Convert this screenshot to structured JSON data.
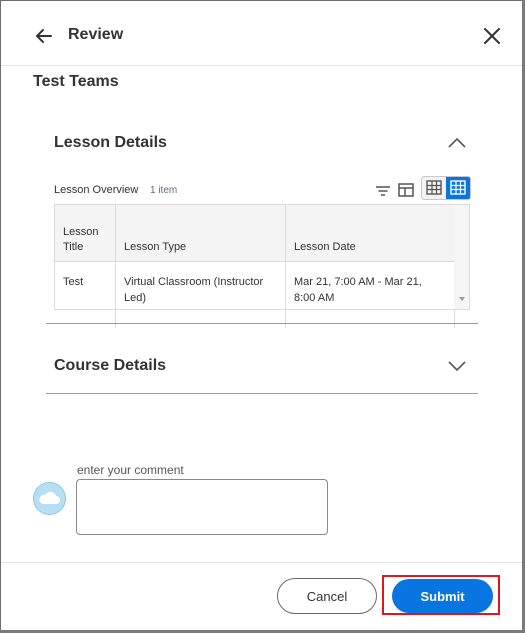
{
  "header": {
    "title": "Review"
  },
  "page_title": "Test Teams",
  "lesson_section": {
    "title": "Lesson Details",
    "overview_label": "Lesson Overview",
    "item_count": "1 item",
    "table": {
      "columns": [
        "Lesson Title",
        "Lesson Type",
        "Lesson Date"
      ],
      "rows": [
        [
          "Test",
          "Virtual Classroom (Instructor Led)",
          "Mar 21, 7:00 AM - Mar 21, 8:00 AM"
        ]
      ]
    }
  },
  "course_section": {
    "title": "Course Details"
  },
  "comment": {
    "placeholder": "enter your comment"
  },
  "footer": {
    "cancel_label": "Cancel",
    "submit_label": "Submit"
  },
  "colors": {
    "primary": "#0875e1",
    "highlight": "#e0161c",
    "avatar": "#b7dff3"
  },
  "icons": [
    "back-arrow-icon",
    "close-icon",
    "chevron-up-icon",
    "chevron-down-icon",
    "filter-icon",
    "columns-icon",
    "table-view-icon",
    "grid-view-icon",
    "cloud-avatar-icon"
  ]
}
